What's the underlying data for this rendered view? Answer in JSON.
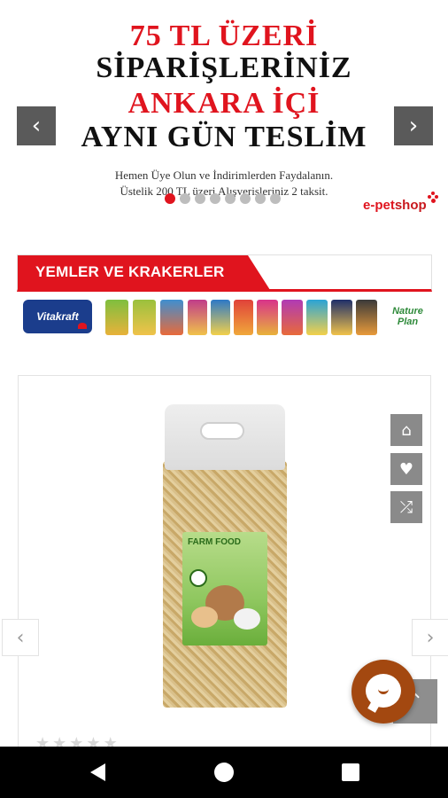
{
  "hero": {
    "line1": "75 TL ÜZERİ",
    "line2": "SİPARİŞLERİNİZ",
    "line3": "ANKARA İÇİ",
    "line4": "AYNI GÜN TESLİM",
    "sub1": "Hemen Üye Olun ve İndirimlerden Faydalanın.",
    "sub2": "Üstelik 200 TL üzeri Alışverişleriniz 2 taksit.",
    "brand_e": "e-pet",
    "brand_shop": "shop",
    "prev_icon": "chevron-left-icon",
    "next_icon": "chevron-right-icon",
    "slide_count": 8,
    "active_slide": 1
  },
  "category": {
    "title": "YEMLER VE KRAKERLER",
    "brand_left": "Vitakraft",
    "brand_right": "Nature Plan"
  },
  "product": {
    "bag_brand": "FARM FOOD",
    "actions": [
      {
        "icon": "basket-icon"
      },
      {
        "icon": "heart-icon"
      },
      {
        "icon": "shuffle-icon"
      }
    ],
    "rating": 0,
    "rating_max": 5
  },
  "colors": {
    "accent_red": "#e0141e",
    "chat_brown": "#a34810",
    "button_gray": "#8a8a8a"
  },
  "nav": {
    "back_icon": "back-triangle-icon",
    "home_icon": "home-circle-icon",
    "recent_icon": "recent-square-icon"
  }
}
